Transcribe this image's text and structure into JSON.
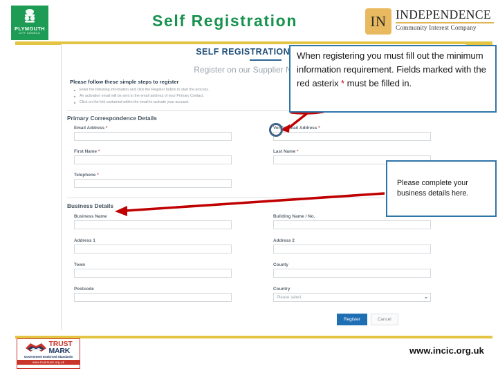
{
  "slide": {
    "title": "Self Registration"
  },
  "header": {
    "council_logo": {
      "name": "PLYMOUTH",
      "sub": "CITY COUNCIL",
      "color": "#1e9c55"
    },
    "partner_logo": {
      "mark": "IN",
      "name": "INDEPENDENCE",
      "tagline": "Community Interest Company",
      "color": "#e8b95e"
    }
  },
  "screenshot": {
    "title": "SELF REGISTRATION",
    "subtitle": "Register on our Supplier Network",
    "lead": "Please follow these simple steps to register",
    "bullets": [
      "Enter the following information and click the Register button to start the process.",
      "An activation email will be sent to the email address of your Primary Contact.",
      "Click on the link contained within the email to activate your account."
    ],
    "primary_section": {
      "title": "Primary Correspondence Details",
      "fields": [
        {
          "label": "Email Address",
          "required": true,
          "value": "",
          "col": "left",
          "row": 0
        },
        {
          "label": "Verify Email Address",
          "required": true,
          "value": "",
          "col": "right",
          "row": 0
        },
        {
          "label": "First Name",
          "required": true,
          "value": "",
          "col": "left",
          "row": 1
        },
        {
          "label": "Last Name",
          "required": true,
          "value": "",
          "col": "right",
          "row": 1
        },
        {
          "label": "Telephone",
          "required": true,
          "value": "",
          "col": "left",
          "row": 2
        }
      ]
    },
    "business_section": {
      "title": "Business Details",
      "fields": [
        {
          "label": "Business Name",
          "required": false,
          "value": "",
          "col": "left",
          "row": 0
        },
        {
          "label": "Building Name / No.",
          "required": false,
          "value": "",
          "col": "right",
          "row": 0
        },
        {
          "label": "Address 1",
          "required": false,
          "value": "",
          "col": "left",
          "row": 1
        },
        {
          "label": "Address 2",
          "required": false,
          "value": "",
          "col": "right",
          "row": 1
        },
        {
          "label": "Town",
          "required": false,
          "value": "",
          "col": "left",
          "row": 2
        },
        {
          "label": "County",
          "required": false,
          "value": "",
          "col": "right",
          "row": 2
        },
        {
          "label": "Postcode",
          "required": false,
          "value": "",
          "col": "left",
          "row": 3
        }
      ],
      "country_field": {
        "label": "Country",
        "placeholder": "Please select",
        "selected": "Please select"
      }
    },
    "buttons": {
      "register": "Register",
      "cancel": "Cancel"
    }
  },
  "annotations": {
    "callout_1": {
      "text_part_1": "When registering you must fill out the minimum information requirement. Fields marked with the red asterix ",
      "asterisk": "*",
      "text_part_2": " must be filled in.",
      "border_color": "#2e75a8"
    },
    "callout_2": {
      "text": "Please complete your business details here.",
      "border_color": "#2e75a8"
    },
    "arrow_color": "#c00000",
    "highlight_circle_color": "#3f6287"
  },
  "footer": {
    "trustmark": {
      "word_1": "TRUST",
      "word_2": "MARK",
      "standards": "Government Endorsed Standards",
      "url": "www.trustmark.org.uk"
    },
    "website": "www.incic.org.uk"
  }
}
